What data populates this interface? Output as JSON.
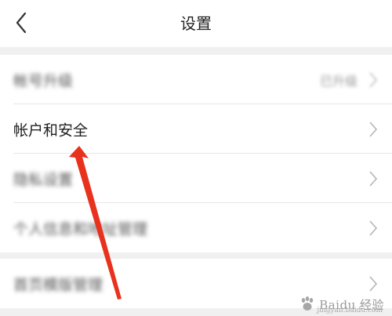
{
  "header": {
    "title": "设置",
    "back_icon": "chevron-left-icon"
  },
  "settings": {
    "group1": [
      {
        "label": "帐号升级",
        "value": "已升级",
        "blurred": true
      },
      {
        "label": "帐户和安全",
        "blurred": false
      },
      {
        "label": "隐私设置",
        "blurred": true
      },
      {
        "label": "个人信息和地址管理",
        "blurred": true
      }
    ],
    "group2": [
      {
        "label": "首页模版管理",
        "blurred": true
      }
    ]
  },
  "annotation": {
    "color": "#e8321e",
    "icon": "red-arrow-icon"
  },
  "watermark": {
    "brand": "Baidu 经验",
    "url": "jingyan.baidu.com"
  }
}
